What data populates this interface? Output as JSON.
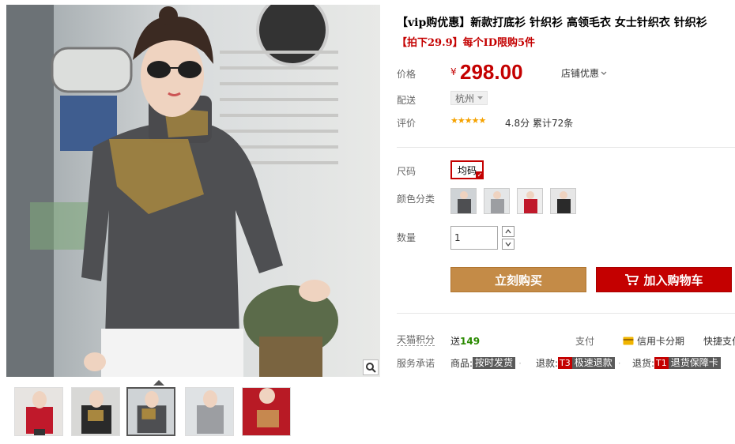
{
  "product": {
    "title": "【vip购优惠】新款打底衫 针织衫 高领毛衣 女士针织衣 针织衫",
    "subtitle": "【拍下29.9】每个ID限购5件"
  },
  "price": {
    "label": "价格",
    "currency": "¥",
    "value": "298.00",
    "promo_label": "店铺优惠"
  },
  "shipping": {
    "label": "配送",
    "city": "杭州"
  },
  "reviews": {
    "label": "评价",
    "rating": "4.8分",
    "total": "累计72条",
    "stars": 5
  },
  "size": {
    "label": "尺码",
    "selected": "均码"
  },
  "color": {
    "label": "颜色分类",
    "swatches": [
      "grey-model",
      "light-grey",
      "red",
      "black"
    ]
  },
  "quantity": {
    "label": "数量",
    "value": "1"
  },
  "actions": {
    "buy_now": "立刻购买",
    "add_to_cart": "加入购物车"
  },
  "points": {
    "label": "天猫积分",
    "prefix": "送",
    "value": "149"
  },
  "payment": {
    "label": "支付",
    "credit": "信用卡分期",
    "quick": "快捷支付"
  },
  "service": {
    "label": "服务承诺",
    "items": [
      {
        "prefix": "商品:",
        "badge": "",
        "tag": "按时发货"
      },
      {
        "prefix": "退款:",
        "badge": "T3",
        "tag": "极速退款"
      },
      {
        "prefix": "退货:",
        "badge": "T1",
        "tag": "退货保障卡"
      }
    ]
  },
  "gallery": {
    "thumbnails": [
      "red-sweater",
      "black-sweater",
      "grey-sweater",
      "light-grey-sweater",
      "red-closeup"
    ],
    "active_index": 2
  },
  "colors": {
    "accent_red": "#c40000",
    "buy_button": "#c48b47",
    "stars": "#f5a200",
    "points_green": "#2a8a00"
  }
}
